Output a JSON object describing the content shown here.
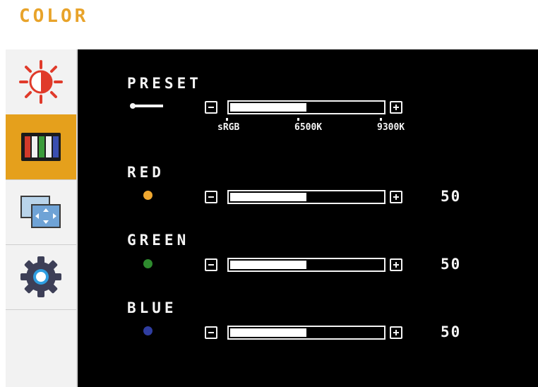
{
  "menu": {
    "title": "COLOR",
    "accent_color": "#e8a32a"
  },
  "sidebar": {
    "items": [
      {
        "icon": "brightness-contrast-icon",
        "active": false
      },
      {
        "icon": "color-bars-icon",
        "active": true
      },
      {
        "icon": "image-position-icon",
        "active": false
      },
      {
        "icon": "settings-gear-icon",
        "active": false
      }
    ]
  },
  "preset": {
    "label": "PRESET",
    "icon": "key-icon",
    "level": 0.5,
    "options": [
      "sRGB",
      "6500K",
      "9300K"
    ]
  },
  "channels": [
    {
      "label": "RED",
      "color": "#f0a830",
      "value": "50",
      "level": 0.5
    },
    {
      "label": "GREEN",
      "color": "#2e8b2e",
      "value": "50",
      "level": 0.5
    },
    {
      "label": "BLUE",
      "color": "#2f3da0",
      "value": "50",
      "level": 0.5
    }
  ]
}
